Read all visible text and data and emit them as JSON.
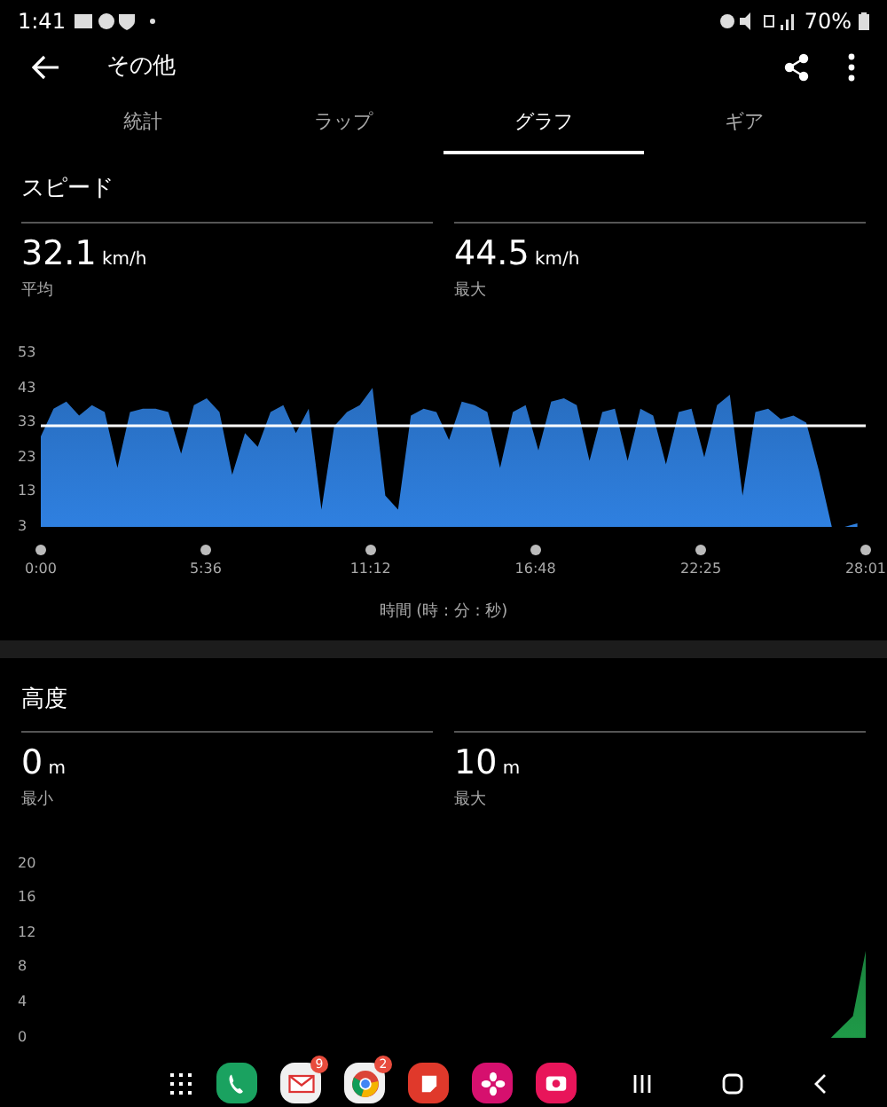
{
  "status_bar": {
    "time": "1:41",
    "battery": "70%"
  },
  "app_bar": {
    "title": "その他"
  },
  "tabs": [
    {
      "label": "統計",
      "selected": false
    },
    {
      "label": "ラップ",
      "selected": false
    },
    {
      "label": "グラフ",
      "selected": true
    },
    {
      "label": "ギア",
      "selected": false
    }
  ],
  "sections": [
    {
      "title": "スピード",
      "stats": [
        {
          "value": "32.1",
          "unit": "km/h",
          "label": "平均"
        },
        {
          "value": "44.5",
          "unit": "km/h",
          "label": "最大"
        }
      ],
      "chart_data": {
        "type": "area",
        "xlabel": "時間 (時 : 分 : 秒)",
        "xlim": [
          0,
          1681
        ],
        "ylim": [
          3,
          53
        ],
        "yticks": [
          53,
          43,
          33,
          23,
          13,
          3
        ],
        "xticks": [
          {
            "value": 0,
            "label": "0:00"
          },
          {
            "value": 336,
            "label": "5:36"
          },
          {
            "value": 672,
            "label": "11:12"
          },
          {
            "value": 1008,
            "label": "16:48"
          },
          {
            "value": 1345,
            "label": "22:25"
          },
          {
            "value": 1681,
            "label": "28:01"
          }
        ],
        "ref_lines": [
          {
            "axis": "y",
            "value": 32.1
          }
        ],
        "x": [
          0,
          26,
          52,
          78,
          104,
          130,
          156,
          182,
          208,
          234,
          260,
          286,
          312,
          338,
          364,
          390,
          416,
          442,
          468,
          494,
          520,
          546,
          572,
          598,
          624,
          650,
          676,
          702,
          728,
          754,
          780,
          806,
          832,
          858,
          884,
          910,
          936,
          962,
          988,
          1014,
          1040,
          1066,
          1092,
          1118,
          1144,
          1170,
          1196,
          1222,
          1248,
          1274,
          1300,
          1326,
          1352,
          1378,
          1404,
          1430,
          1456,
          1482,
          1508,
          1534,
          1560,
          1586,
          1612,
          1638,
          1664
        ],
        "series": [
          {
            "color": "#2f80e0",
            "values": [
              29,
              37,
              39,
              35,
              38,
              36,
              20,
              36,
              37,
              37,
              36,
              24,
              38,
              40,
              36,
              18,
              30,
              26,
              36,
              38,
              30,
              37,
              8,
              32,
              36,
              38,
              43,
              12,
              8,
              35,
              37,
              36,
              28,
              39,
              38,
              36,
              20,
              36,
              38,
              25,
              39,
              40,
              38,
              22,
              36,
              37,
              22,
              37,
              35,
              21,
              36,
              37,
              23,
              38,
              41,
              12,
              36,
              37,
              34,
              35,
              33,
              19,
              3,
              3,
              4
            ]
          }
        ]
      }
    },
    {
      "title": "高度",
      "stats": [
        {
          "value": "0",
          "unit": "m",
          "label": "最小"
        },
        {
          "value": "10",
          "unit": "m",
          "label": "最大"
        }
      ],
      "chart_data": {
        "type": "area",
        "xlim": [
          0,
          1681
        ],
        "ylim": [
          0,
          20
        ],
        "yticks": [
          20,
          16,
          12,
          8,
          4,
          0
        ],
        "x": [
          1610,
          1655,
          1681
        ],
        "series": [
          {
            "color": "#1f9a48",
            "values": [
              0,
              2.5,
              10
            ]
          }
        ]
      }
    }
  ],
  "dock": {
    "apps": [
      {
        "kind": "phone",
        "color": "#1aa260"
      },
      {
        "kind": "mail",
        "color": "#f0f0f0",
        "badge": "9"
      },
      {
        "kind": "browser",
        "color": "#f0f0f0",
        "badge": "2"
      },
      {
        "kind": "notes",
        "color": "#e0392b"
      },
      {
        "kind": "flower",
        "color": "#d6106e"
      },
      {
        "kind": "camera",
        "color": "#e8155a"
      }
    ]
  }
}
